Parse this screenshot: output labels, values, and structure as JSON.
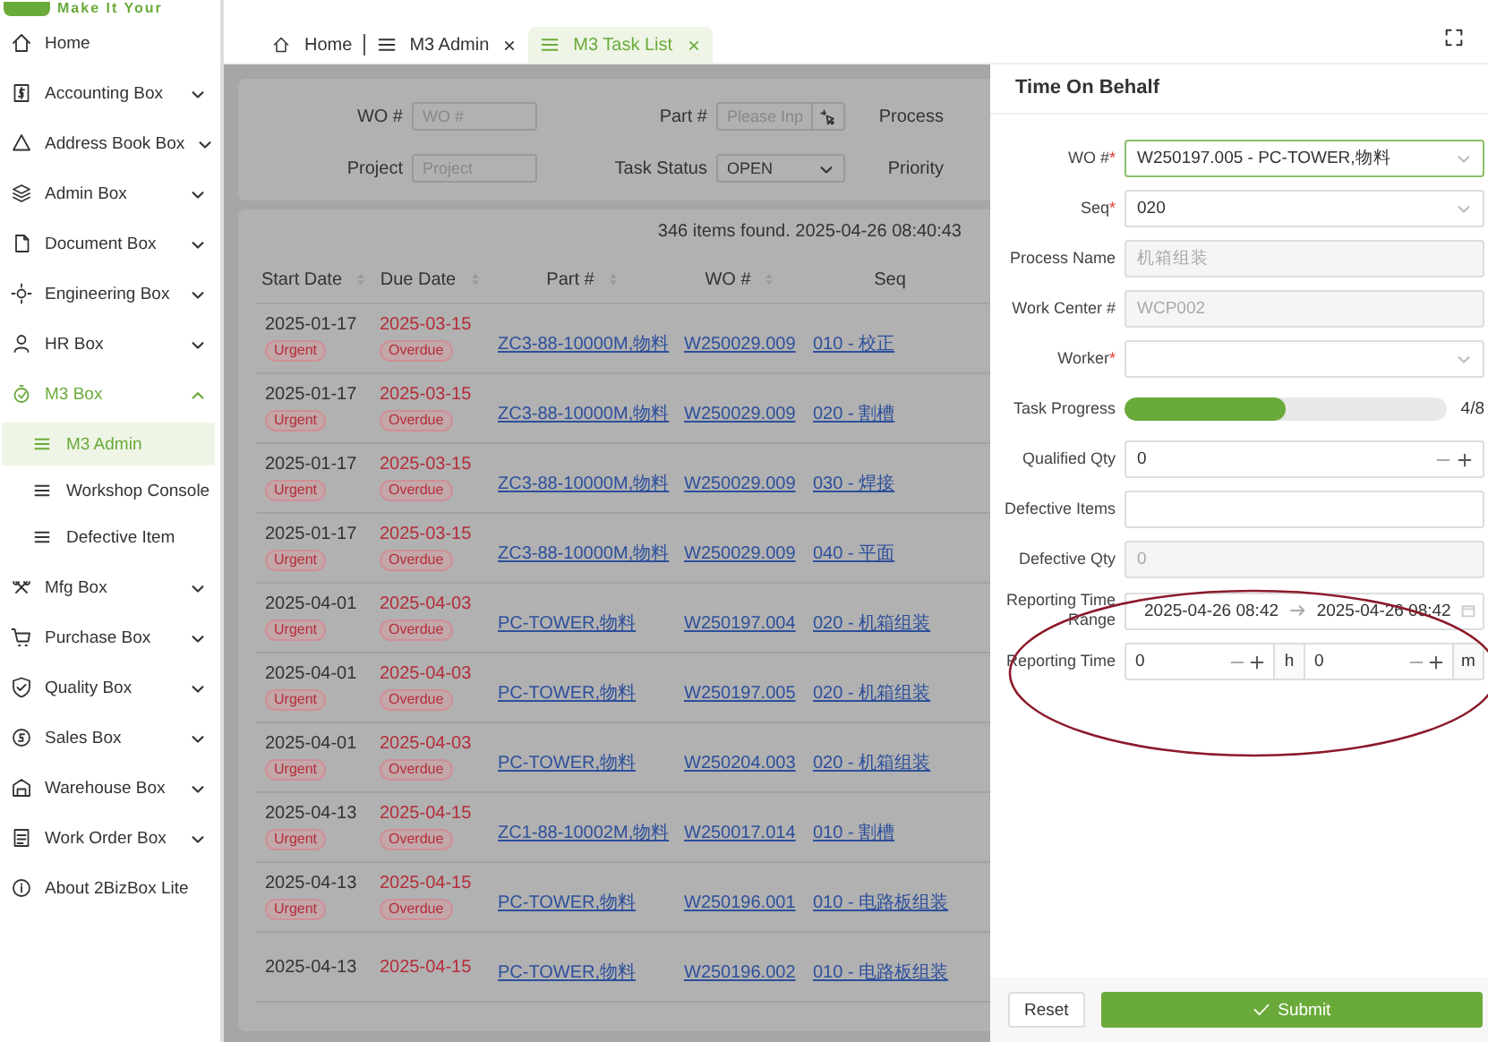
{
  "logo": {
    "tagline": "Make It Your"
  },
  "sidebar": {
    "items": [
      {
        "label": "Home",
        "kind": "link",
        "selected": false
      },
      {
        "label": "Accounting Box",
        "kind": "group",
        "expanded": false,
        "selected": false
      },
      {
        "label": "Address Book Box",
        "kind": "group",
        "expanded": false,
        "selected": false
      },
      {
        "label": "Admin Box",
        "kind": "group",
        "expanded": false,
        "selected": false
      },
      {
        "label": "Document Box",
        "kind": "group",
        "expanded": false,
        "selected": false
      },
      {
        "label": "Engineering Box",
        "kind": "group",
        "expanded": false,
        "selected": false
      },
      {
        "label": "HR Box",
        "kind": "group",
        "expanded": false,
        "selected": false
      },
      {
        "label": "M3 Box",
        "kind": "group",
        "expanded": true,
        "selected": true,
        "children": [
          {
            "label": "M3 Admin",
            "selected": true
          },
          {
            "label": "Workshop Console",
            "selected": false
          },
          {
            "label": "Defective Item",
            "selected": false
          }
        ]
      },
      {
        "label": "Mfg Box",
        "kind": "group",
        "expanded": false,
        "selected": false
      },
      {
        "label": "Purchase Box",
        "kind": "group",
        "expanded": false,
        "selected": false
      },
      {
        "label": "Quality Box",
        "kind": "group",
        "expanded": false,
        "selected": false
      },
      {
        "label": "Sales Box",
        "kind": "group",
        "expanded": false,
        "selected": false
      },
      {
        "label": "Warehouse Box",
        "kind": "group",
        "expanded": false,
        "selected": false
      },
      {
        "label": "Work Order Box",
        "kind": "group",
        "expanded": false,
        "selected": false
      },
      {
        "label": "About 2BizBox Lite",
        "kind": "link",
        "selected": false
      }
    ]
  },
  "tabs": [
    {
      "label": "Home",
      "kind": "home",
      "selected": false,
      "closable": false
    },
    {
      "label": "M3 Admin",
      "kind": "page",
      "selected": false,
      "closable": true
    },
    {
      "label": "M3 Task List",
      "kind": "page",
      "selected": true,
      "closable": true
    }
  ],
  "filters": {
    "rows": [
      [
        {
          "label": "WO #",
          "kind": "text",
          "placeholder": "WO #"
        },
        {
          "label": "Part #",
          "kind": "picker",
          "placeholder": "Please Inp"
        },
        {
          "label": "Process",
          "kind": "label"
        }
      ],
      [
        {
          "label": "Project",
          "kind": "text",
          "placeholder": "Project"
        },
        {
          "label": "Task Status",
          "kind": "select",
          "value": "OPEN"
        },
        {
          "label": "Priority",
          "kind": "label"
        }
      ]
    ]
  },
  "summary": "346 items found. 2025-04-26 08:40:43",
  "table": {
    "columns": [
      {
        "label": "Start Date",
        "sortable": true
      },
      {
        "label": "Due Date",
        "sortable": true
      },
      {
        "label": "Part #",
        "sortable": true
      },
      {
        "label": "WO #",
        "sortable": true
      },
      {
        "label": "Seq",
        "sortable": false
      }
    ],
    "rows": [
      {
        "start_date": "2025-01-17",
        "priority": "Urgent",
        "due_date": "2025-03-15",
        "status": "Overdue",
        "part": "ZC3-88-10000M,物料",
        "wo": "W250029.009",
        "seq": "010 - 校正"
      },
      {
        "start_date": "2025-01-17",
        "priority": "Urgent",
        "due_date": "2025-03-15",
        "status": "Overdue",
        "part": "ZC3-88-10000M,物料",
        "wo": "W250029.009",
        "seq": "020 - 割槽"
      },
      {
        "start_date": "2025-01-17",
        "priority": "Urgent",
        "due_date": "2025-03-15",
        "status": "Overdue",
        "part": "ZC3-88-10000M,物料",
        "wo": "W250029.009",
        "seq": "030 - 焊接"
      },
      {
        "start_date": "2025-01-17",
        "priority": "Urgent",
        "due_date": "2025-03-15",
        "status": "Overdue",
        "part": "ZC3-88-10000M,物料",
        "wo": "W250029.009",
        "seq": "040 - 平面"
      },
      {
        "start_date": "2025-04-01",
        "priority": "Urgent",
        "due_date": "2025-04-03",
        "status": "Overdue",
        "part": "PC-TOWER,物料",
        "wo": "W250197.004",
        "seq": "020 - 机箱组装"
      },
      {
        "start_date": "2025-04-01",
        "priority": "Urgent",
        "due_date": "2025-04-03",
        "status": "Overdue",
        "part": "PC-TOWER,物料",
        "wo": "W250197.005",
        "seq": "020 - 机箱组装"
      },
      {
        "start_date": "2025-04-01",
        "priority": "Urgent",
        "due_date": "2025-04-03",
        "status": "Overdue",
        "part": "PC-TOWER,物料",
        "wo": "W250204.003",
        "seq": "020 - 机箱组装"
      },
      {
        "start_date": "2025-04-13",
        "priority": "Urgent",
        "due_date": "2025-04-15",
        "status": "Overdue",
        "part": "ZC1-88-10002M,物料",
        "wo": "W250017.014",
        "seq": "010 - 割槽"
      },
      {
        "start_date": "2025-04-13",
        "priority": "Urgent",
        "due_date": "2025-04-15",
        "status": "Overdue",
        "part": "PC-TOWER,物料",
        "wo": "W250196.001",
        "seq": "010 - 电路板组装"
      },
      {
        "start_date": "2025-04-13",
        "due_date": "2025-04-15",
        "part": "PC-TOWER,物料",
        "wo": "W250196.002",
        "seq": "010 - 电路板组装"
      }
    ]
  },
  "drawer": {
    "title": "Time On Behalf",
    "fields": [
      {
        "label": "WO #",
        "required_mark": "*",
        "kind": "select",
        "value": "W250197.005 - PC-TOWER,物料",
        "focused": true
      },
      {
        "label": "Seq",
        "required_mark": "*",
        "kind": "select",
        "value": "020",
        "focused": false
      },
      {
        "label": "Process Name",
        "kind": "disabled",
        "value": "机箱组装"
      },
      {
        "label": "Work Center #",
        "kind": "disabled",
        "value": "WCP002"
      },
      {
        "label": "Worker",
        "required_mark": "*",
        "kind": "select",
        "focused": false
      },
      {
        "label": "Task Progress",
        "kind": "progress",
        "level": 0.5,
        "reading": "4/8"
      },
      {
        "label": "Qualified Qty",
        "kind": "number",
        "value": "0"
      },
      {
        "label": "Defective Items",
        "kind": "text"
      },
      {
        "label": "Defective Qty",
        "kind": "disabled",
        "value": "0"
      },
      {
        "label": "Reporting Time Range",
        "kind": "daterange",
        "start": "2025-04-26 08:42",
        "end": "2025-04-26 08:42"
      },
      {
        "label": "Reporting Time",
        "kind": "duration",
        "hours": "0",
        "hours_unit": "h",
        "minutes": "0",
        "minutes_unit": "m"
      }
    ],
    "buttons": [
      {
        "label": "Reset",
        "kind": "secondary"
      },
      {
        "label": "Submit",
        "kind": "primary"
      }
    ]
  },
  "annotations": [
    {
      "color": "#8b1a2a"
    }
  ]
}
